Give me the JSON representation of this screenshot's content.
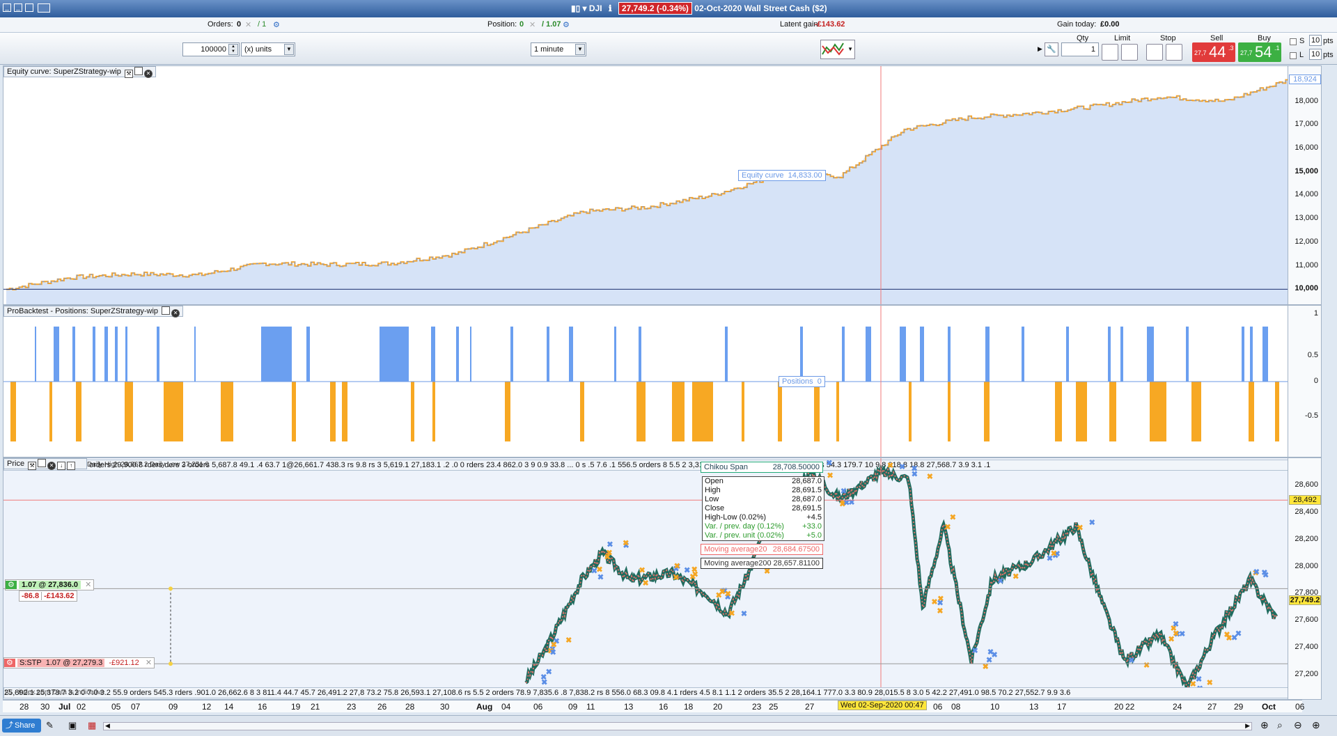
{
  "title_bar": {
    "instrument": "DJI",
    "price_change": "27,749.2 (-0.34%)",
    "date": "02-Oct-2020",
    "market": "Wall Street Cash ($2)"
  },
  "info_bar": {
    "orders_label": "Orders:",
    "orders_value": "0",
    "orders_sep": "/ 1",
    "position_label": "Position:",
    "position_value": "0",
    "position_sep": "/ 1.07",
    "latent_label": "Latent gain:",
    "latent_value": "-£143.62",
    "gain_today_label": "Gain today:",
    "gain_today_value": "£0.00"
  },
  "toolbar": {
    "qty_amount": "100000",
    "units": "(x) units",
    "timeframe": "1 minute"
  },
  "trade_box": {
    "qty_label": "Qty",
    "qty_value": "1",
    "limit_label": "Limit",
    "stop_label": "Stop",
    "sell_label": "Sell",
    "buy_label": "Buy",
    "sell_prefix": "27,7",
    "sell_price": "44",
    "sell_sup": ".3",
    "buy_prefix": "27,7",
    "buy_price": "54",
    "buy_sup": ".1",
    "s_label": "S",
    "l_label": "L",
    "pts_s": "10",
    "pts_l": "10",
    "pts_unit": "pts"
  },
  "equity_panel": {
    "title": "Equity curve: SuperZStrategy-wip",
    "bubble_label": "Equity curve",
    "bubble_value": "14,833.00",
    "last_value": "18,924",
    "yticks": [
      "18,000",
      "17,000",
      "16,000",
      "15,000",
      "14,000",
      "13,000",
      "12,000",
      "11,000",
      "10,000"
    ]
  },
  "positions_panel": {
    "title": "ProBacktest - Positions: SuperZStrategy-wip",
    "bubble_label": "Positions",
    "bubble_value": "0",
    "yticks": [
      "1",
      "0.5",
      "0",
      "-0.5"
    ]
  },
  "price_panel": {
    "title": "Price",
    "header_overlay": "Daily High 28,867.2  Daily Low 27,251.0",
    "strip_text": "orders 29,900.8 rders ders    3 orders 5,687.8 49.1 .4 63.7  1@26,661.7 438.3 rs 9.8 rs 3 5,619.1 27,183.1 .2 .0 0 rders 23.4 862.0 3 9 0.9 33.8 ... 0 s .5 7.6 .1 556.5 orders 8 5.5 2 3,318.6 893.5 s 7,783.0 3 8,097.5 5.3 rs 54.3 179.7 10 9.8 018.8 18.8 27,568.7 3.9 3.1 .1",
    "bottom_strip_text": "25,892.1 25,378.7 3.2 0 7.0 3.2 55.9 orders 545.3 rders  .901.0 26,662.6 8 3 811.4 44.7 45.7 26,491.2 27,8 73.2 75.8 26,593.1 27,108.6 rs 5.5 2 orders 78.9 7,835.6 .8 7,838.2 rs 8 556.0 68.3 09.8 4.1 rders 4.5 8.1 1.1  2 orders 35.5 2 28,164.1 777.0 3.3 80.9 28,015.5 8 3.0 5 42.2 27,491.0 98.5 70.2 27,552.7 9.9 3.6",
    "yticks": [
      "28,600",
      "28,400",
      "28,200",
      "28,000",
      "27,800",
      "27,600",
      "27,400",
      "27,200"
    ],
    "crosshair_value": "28,492",
    "last_price": "27,749.2",
    "footer_note": "IG - index.com Data is indicative",
    "position_tag": {
      "qty_price": "1.07 @ 27,836.0",
      "points": "-86.8",
      "pnl": "-£143.62"
    },
    "stop_tag": {
      "label": "S:STP",
      "qty_price": "1.07 @ 27,279.3",
      "pnl": "-£921.12"
    }
  },
  "tooltip": {
    "chikou_label": "Chikou Span",
    "chikou_value": "28,708.50000",
    "rows": [
      {
        "label": "Open",
        "value": "28,687.0"
      },
      {
        "label": "High",
        "value": "28,691.5"
      },
      {
        "label": "Low",
        "value": "28,687.0"
      },
      {
        "label": "Close",
        "value": "28,691.5"
      },
      {
        "label": "High-Low (0.02%)",
        "value": "+4.5"
      },
      {
        "label": "Var. / prev. day (0.12%)",
        "value": "+33.0"
      },
      {
        "label": "Var. / prev. unit (0.02%)",
        "value": "+5.0"
      }
    ],
    "ma20_label": "Moving average20",
    "ma20_value": "28,684.67500",
    "ma200_label": "Moving average200",
    "ma200_value": "28,657.81100"
  },
  "x_axis": {
    "labels": [
      "28",
      "30",
      "Jul",
      "02",
      "05",
      "07",
      "09",
      "12",
      "14",
      "16",
      "19",
      "21",
      "23",
      "26",
      "28",
      "30",
      "Aug",
      "04",
      "06",
      "09",
      "11",
      "13",
      "16",
      "18",
      "20",
      "23",
      "25",
      "27",
      "06",
      "08",
      "10",
      "13",
      "17",
      "20",
      "22",
      "24",
      "27",
      "29",
      "Oct",
      "06"
    ],
    "cursor_date": "Wed 02-Sep-2020 00:47"
  },
  "status_bar": {
    "share_label": "Share"
  },
  "colors": {
    "equity_fill": "#d6e3f7",
    "equity_line_up": "#6b99e6",
    "equity_line_down": "#f3a531",
    "long_bar": "#6b9ff0",
    "short_bar": "#f7a823",
    "sell": "#e13b3b",
    "buy": "#3cb043"
  },
  "chart_data": [
    {
      "type": "area",
      "title": "Equity curve: SuperZStrategy-wip",
      "x": [
        0,
        5,
        10,
        15,
        20,
        25,
        30,
        35,
        40,
        45,
        50,
        55,
        60,
        65,
        70,
        75,
        80,
        85,
        90,
        95,
        100
      ],
      "y": [
        10000,
        10500,
        10650,
        10600,
        11100,
        11050,
        11100,
        11500,
        12400,
        13300,
        13500,
        14000,
        14833,
        14820,
        16800,
        17300,
        17500,
        17800,
        18200,
        18000,
        18924
      ],
      "ylim": [
        9300,
        19500
      ]
    },
    {
      "type": "bar",
      "title": "ProBacktest - Positions: SuperZStrategy-wip",
      "ylim": [
        -1,
        1
      ]
    },
    {
      "type": "line",
      "title": "Price",
      "ylim": [
        27100,
        28700
      ]
    }
  ]
}
